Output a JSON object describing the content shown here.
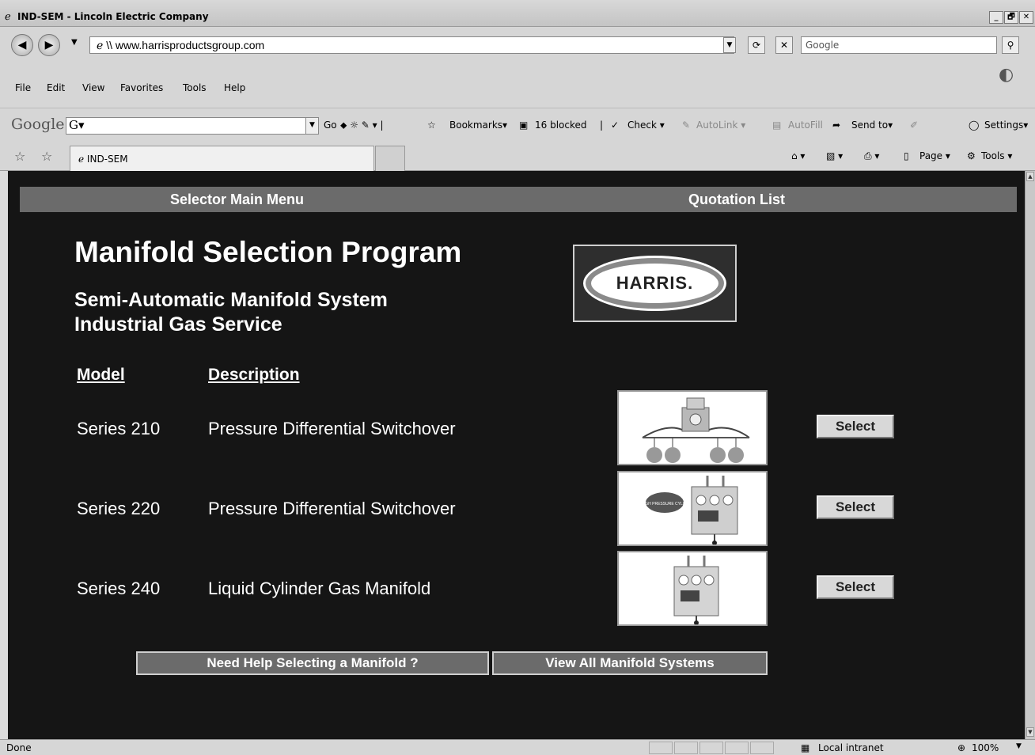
{
  "window": {
    "title": "IND-SEM - Lincoln Electric Company",
    "min": "_",
    "max": "🗗",
    "close": "✕"
  },
  "address_bar": {
    "url": "\\\\ www.harrisproductsgroup.com",
    "search_placeholder": "Google"
  },
  "menu": [
    "File",
    "Edit",
    "View",
    "Favorites",
    "Tools",
    "Help"
  ],
  "google_toolbar": {
    "logo": "Google",
    "search_prefix": "G▾",
    "go": "Go",
    "bookmarks": "Bookmarks▾",
    "blocked": "16 blocked",
    "check": "Check ▾",
    "autolink": "AutoLink ▾",
    "autofill": "AutoFill",
    "send_to": "Send to▾",
    "settings": "Settings▾"
  },
  "tab": {
    "label": "IND-SEM"
  },
  "tab_tools": {
    "page": "Page ▾",
    "tools": "Tools ▾"
  },
  "nav": {
    "main_menu": "Selector Main Menu",
    "quotation_list": "Quotation List"
  },
  "heading": {
    "title": "Manifold Selection Program",
    "subtitle_line1": "Semi-Automatic Manifold System",
    "subtitle_line2": "Industrial Gas Service"
  },
  "logo": {
    "text": "HARRIS."
  },
  "columns": {
    "model": "Model",
    "description": "Description"
  },
  "rows": [
    {
      "model": "Series 210",
      "description": "Pressure Differential Switchover",
      "select": "Select"
    },
    {
      "model": "Series 220",
      "description": "Pressure Differential Switchover",
      "select": "Select",
      "thumb_label": "FOR HIGH PRESSURE CYLINDERS"
    },
    {
      "model": "Series 240",
      "description": "Liquid Cylinder Gas Manifold",
      "select": "Select"
    }
  ],
  "buttons": {
    "help": "Need Help Selecting a Manifold ?",
    "view_all": "View All Manifold Systems"
  },
  "status": {
    "text": "Done",
    "zone": "Local intranet",
    "zoom": "100%"
  }
}
